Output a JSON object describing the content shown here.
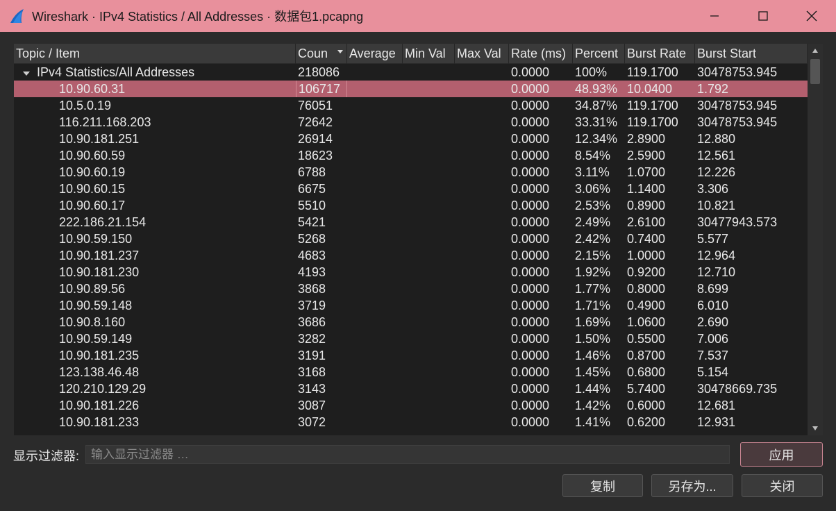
{
  "window": {
    "title": "Wireshark · IPv4 Statistics / All Addresses · 数据包1.pcapng",
    "accent_color": "#e8909c"
  },
  "table": {
    "columns": [
      "Topic / Item",
      "Count",
      "Average",
      "Min Val",
      "Max Val",
      "Rate (ms)",
      "Percent",
      "Burst Rate",
      "Burst Start"
    ],
    "column_display": [
      "Topic / Item",
      "Coun",
      "Average",
      "Min Val",
      "Max Val",
      "Rate (ms)",
      "Percent",
      "Burst Rate",
      "Burst Start"
    ],
    "sorted_column": "Count",
    "sort_order": "descending",
    "parent_row": {
      "topic": "IPv4 Statistics/All Addresses",
      "count": "218086",
      "average": "",
      "min": "",
      "max": "",
      "rate": "0.0000",
      "percent": "100%",
      "burst_rate": "119.1700",
      "burst_start": "30478753.945",
      "expanded": true
    },
    "rows": [
      {
        "topic": "10.90.60.31",
        "count": "106717",
        "rate": "0.0000",
        "percent": "48.93%",
        "burst_rate": "10.0400",
        "burst_start": "1.792",
        "selected": true
      },
      {
        "topic": "10.5.0.19",
        "count": "76051",
        "rate": "0.0000",
        "percent": "34.87%",
        "burst_rate": "119.1700",
        "burst_start": "30478753.945"
      },
      {
        "topic": "116.211.168.203",
        "count": "72642",
        "rate": "0.0000",
        "percent": "33.31%",
        "burst_rate": "119.1700",
        "burst_start": "30478753.945"
      },
      {
        "topic": "10.90.181.251",
        "count": "26914",
        "rate": "0.0000",
        "percent": "12.34%",
        "burst_rate": "2.8900",
        "burst_start": "12.880"
      },
      {
        "topic": "10.90.60.59",
        "count": "18623",
        "rate": "0.0000",
        "percent": "8.54%",
        "burst_rate": "2.5900",
        "burst_start": "12.561"
      },
      {
        "topic": "10.90.60.19",
        "count": "6788",
        "rate": "0.0000",
        "percent": "3.11%",
        "burst_rate": "1.0700",
        "burst_start": "12.226"
      },
      {
        "topic": "10.90.60.15",
        "count": "6675",
        "rate": "0.0000",
        "percent": "3.06%",
        "burst_rate": "1.1400",
        "burst_start": "3.306"
      },
      {
        "topic": "10.90.60.17",
        "count": "5510",
        "rate": "0.0000",
        "percent": "2.53%",
        "burst_rate": "0.8900",
        "burst_start": "10.821"
      },
      {
        "topic": "222.186.21.154",
        "count": "5421",
        "rate": "0.0000",
        "percent": "2.49%",
        "burst_rate": "2.6100",
        "burst_start": "30477943.573"
      },
      {
        "topic": "10.90.59.150",
        "count": "5268",
        "rate": "0.0000",
        "percent": "2.42%",
        "burst_rate": "0.7400",
        "burst_start": "5.577"
      },
      {
        "topic": "10.90.181.237",
        "count": "4683",
        "rate": "0.0000",
        "percent": "2.15%",
        "burst_rate": "1.0000",
        "burst_start": "12.964"
      },
      {
        "topic": "10.90.181.230",
        "count": "4193",
        "rate": "0.0000",
        "percent": "1.92%",
        "burst_rate": "0.9200",
        "burst_start": "12.710"
      },
      {
        "topic": "10.90.89.56",
        "count": "3868",
        "rate": "0.0000",
        "percent": "1.77%",
        "burst_rate": "0.8000",
        "burst_start": "8.699"
      },
      {
        "topic": "10.90.59.148",
        "count": "3719",
        "rate": "0.0000",
        "percent": "1.71%",
        "burst_rate": "0.4900",
        "burst_start": "6.010"
      },
      {
        "topic": "10.90.8.160",
        "count": "3686",
        "rate": "0.0000",
        "percent": "1.69%",
        "burst_rate": "1.0600",
        "burst_start": "2.690"
      },
      {
        "topic": "10.90.59.149",
        "count": "3282",
        "rate": "0.0000",
        "percent": "1.50%",
        "burst_rate": "0.5500",
        "burst_start": "7.006"
      },
      {
        "topic": "10.90.181.235",
        "count": "3191",
        "rate": "0.0000",
        "percent": "1.46%",
        "burst_rate": "0.8700",
        "burst_start": "7.537"
      },
      {
        "topic": "123.138.46.48",
        "count": "3168",
        "rate": "0.0000",
        "percent": "1.45%",
        "burst_rate": "0.6800",
        "burst_start": "5.154"
      },
      {
        "topic": "120.210.129.29",
        "count": "3143",
        "rate": "0.0000",
        "percent": "1.44%",
        "burst_rate": "5.7400",
        "burst_start": "30478669.735"
      },
      {
        "topic": "10.90.181.226",
        "count": "3087",
        "rate": "0.0000",
        "percent": "1.42%",
        "burst_rate": "0.6000",
        "burst_start": "12.681"
      },
      {
        "topic": "10.90.181.233",
        "count": "3072",
        "rate": "0.0000",
        "percent": "1.41%",
        "burst_rate": "0.6200",
        "burst_start": "12.931"
      }
    ]
  },
  "filter": {
    "label": "显示过滤器:",
    "placeholder": "输入显示过滤器 …",
    "value": ""
  },
  "buttons": {
    "apply": "应用",
    "copy": "复制",
    "save_as": "另存为...",
    "close": "关闭"
  }
}
